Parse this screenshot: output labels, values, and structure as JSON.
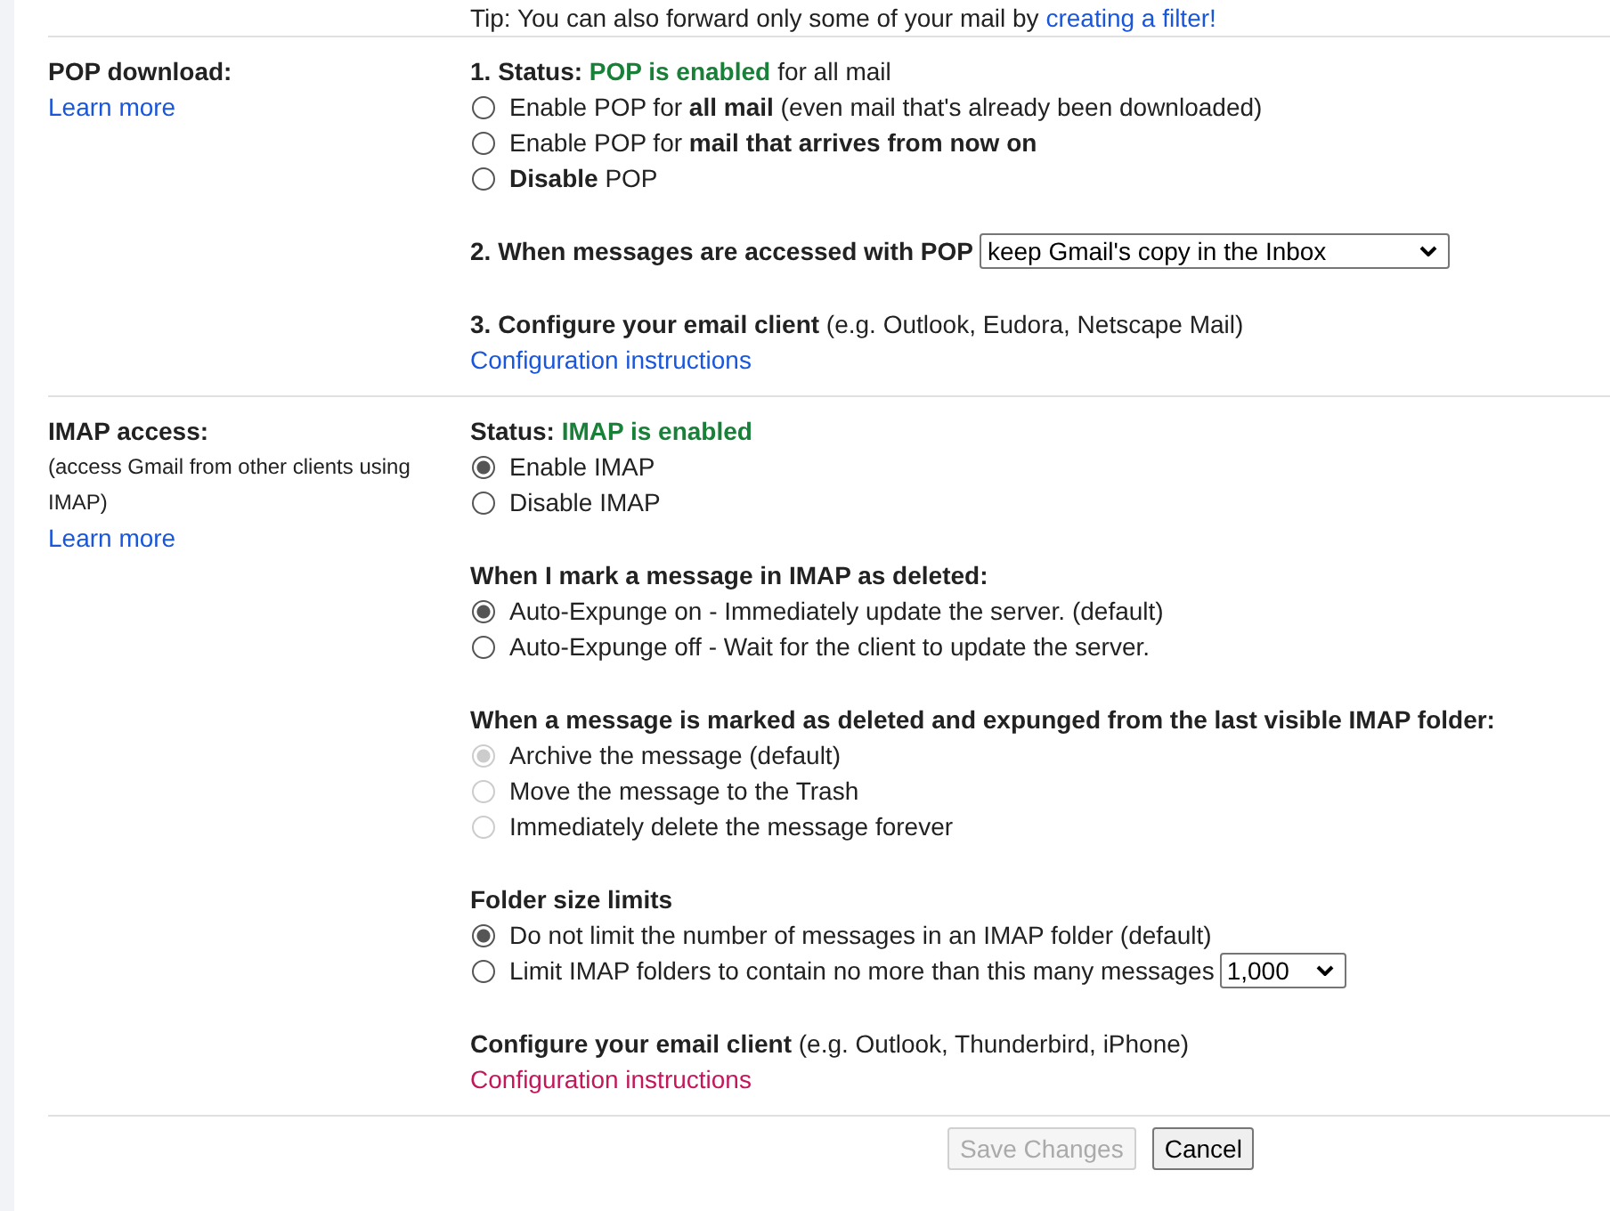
{
  "tip": {
    "text": "Tip: You can also forward only some of your mail by",
    "link": "creating a filter!"
  },
  "sections": [
    {
      "label": "POP download:",
      "learn_more": "Learn more",
      "blocks": [
        {
          "heading": {
            "label": "1. Status:",
            "status": "POP is enabled",
            "rest": "for all mail"
          },
          "options": [
            {
              "text": "Enable POP for **all mail** (even mail that's already been downloaded)",
              "selected": false,
              "disabled": false
            },
            {
              "text": "Enable POP for **mail that arrives from now on**",
              "selected": false,
              "disabled": false
            },
            {
              "text": "**Disable** POP",
              "selected": false,
              "disabled": false
            }
          ]
        },
        {
          "title": "2. When messages are accessed with POP",
          "select": "keep Gmail's copy in the Inbox"
        },
        {
          "title": "**3. Configure your email client** (e.g. Outlook, Eudora, Netscape Mail)",
          "link": {
            "text": "Configuration instructions",
            "visited": false
          }
        }
      ]
    },
    {
      "label": "IMAP access:",
      "note": "(access Gmail from other clients using IMAP)",
      "learn_more": "Learn more",
      "blocks": [
        {
          "heading": {
            "label": "Status:",
            "status": "IMAP is enabled"
          },
          "options": [
            {
              "text": "Enable IMAP",
              "selected": true,
              "disabled": false
            },
            {
              "text": "Disable IMAP",
              "selected": false,
              "disabled": false
            }
          ]
        },
        {
          "title": "When I mark a message in IMAP as deleted:",
          "options": [
            {
              "text": "Auto-Expunge on - Immediately update the server. (default)",
              "selected": true,
              "disabled": false
            },
            {
              "text": "Auto-Expunge off - Wait for the client to update the server.",
              "selected": false,
              "disabled": false
            }
          ]
        },
        {
          "title": "When a message is marked as deleted and expunged from the last visible IMAP folder:",
          "options": [
            {
              "text": "Archive the message (default)",
              "selected": true,
              "disabled": true
            },
            {
              "text": "Move the message to the Trash",
              "selected": false,
              "disabled": true
            },
            {
              "text": "Immediately delete the message forever",
              "selected": false,
              "disabled": true
            }
          ]
        },
        {
          "title": "Folder size limits",
          "options": [
            {
              "text": "Do not limit the number of messages in an IMAP folder (default)",
              "selected": true,
              "disabled": false
            },
            {
              "text": "Limit IMAP folders to contain no more than this many messages",
              "selected": false,
              "disabled": false,
              "select": "1,000"
            }
          ]
        },
        {
          "title": "**Configure your email client** (e.g. Outlook, Thunderbird, iPhone)",
          "link": {
            "text": "Configuration instructions",
            "visited": true
          }
        }
      ]
    }
  ],
  "buttons": [
    {
      "label": "Save Changes",
      "disabled": true
    },
    {
      "label": "Cancel",
      "disabled": false
    }
  ]
}
